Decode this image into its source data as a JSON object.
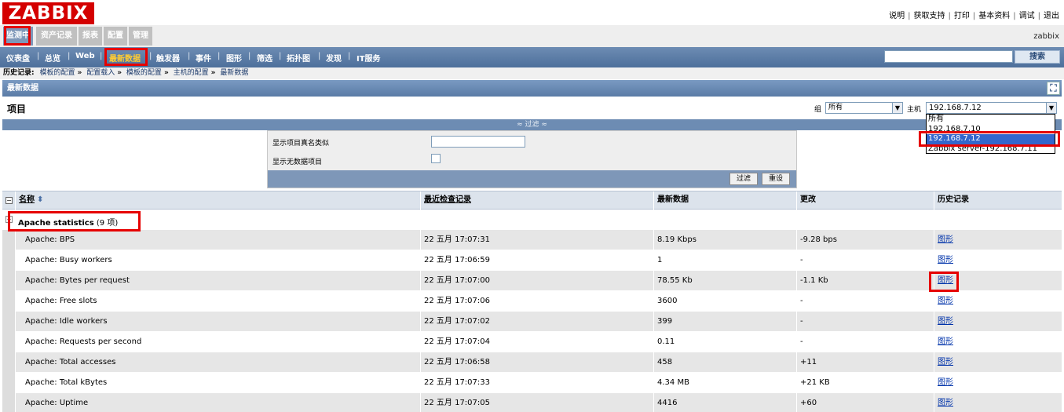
{
  "app": {
    "logo": "ZABBIX",
    "username": "zabbix"
  },
  "top_links": [
    "说明",
    "获取支持",
    "打印",
    "基本资料",
    "调试",
    "退出"
  ],
  "main_menu": [
    "监测中",
    "资产记录",
    "报表",
    "配置",
    "管理"
  ],
  "sub_menu": [
    "仪表盘",
    "总览",
    "Web",
    "最新数据",
    "触发器",
    "事件",
    "图形",
    "筛选",
    "拓扑图",
    "发现",
    "IT服务"
  ],
  "search": {
    "button": "搜索",
    "value": ""
  },
  "breadcrumb": {
    "label": "历史记录:",
    "items": [
      "模板的配置",
      "配置载入",
      "模板的配置",
      "主机的配置",
      "最新数据"
    ],
    "arrow": "»"
  },
  "section_title": "最新数据",
  "items_title": "项目",
  "group_filter": {
    "label": "组",
    "value": "所有"
  },
  "host_filter": {
    "label": "主机",
    "value": "192.168.7.12",
    "options": [
      "所有",
      "192.168.7.10",
      "192.168.7.12",
      "Zabbix server-192.168.7.11"
    ],
    "selected_index": 2
  },
  "filter": {
    "toggle_label": "≈ 过滤 ≈",
    "name_label": "显示项目真名类似",
    "nodata_label": "显示无数据项目",
    "filter_button": "过滤",
    "reset_button": "重设"
  },
  "table": {
    "headers": [
      "名称",
      "最近检查记录",
      "最新数据",
      "更改",
      "历史记录"
    ],
    "group": {
      "name": "Apache statistics",
      "count": "(9 项)"
    },
    "rows": [
      {
        "name": "Apache: BPS",
        "last_check": "22 五月 17:07:31",
        "last_value": "8.19 Kbps",
        "change": "-9.28 bps",
        "history": "图形"
      },
      {
        "name": "Apache: Busy workers",
        "last_check": "22 五月 17:06:59",
        "last_value": "1",
        "change": "-",
        "history": "图形"
      },
      {
        "name": "Apache: Bytes per request",
        "last_check": "22 五月 17:07:00",
        "last_value": "78.55 Kb",
        "change": "-1.1 Kb",
        "history": "图形"
      },
      {
        "name": "Apache: Free slots",
        "last_check": "22 五月 17:07:06",
        "last_value": "3600",
        "change": "-",
        "history": "图形"
      },
      {
        "name": "Apache: Idle workers",
        "last_check": "22 五月 17:07:02",
        "last_value": "399",
        "change": "-",
        "history": "图形"
      },
      {
        "name": "Apache: Requests per second",
        "last_check": "22 五月 17:07:04",
        "last_value": "0.11",
        "change": "-",
        "history": "图形"
      },
      {
        "name": "Apache: Total accesses",
        "last_check": "22 五月 17:06:58",
        "last_value": "458",
        "change": "+11",
        "history": "图形"
      },
      {
        "name": "Apache: Total kBytes",
        "last_check": "22 五月 17:07:33",
        "last_value": "4.34 MB",
        "change": "+21 KB",
        "history": "图形"
      },
      {
        "name": "Apache: Uptime",
        "last_check": "22 五月 17:07:05",
        "last_value": "4416",
        "change": "+60",
        "history": "图形"
      }
    ]
  },
  "colors": {
    "logo_bg": "#d40000",
    "menu_active": "#7e97b8",
    "submenu_active": "#ffcc33",
    "annotation": "#e60000"
  }
}
